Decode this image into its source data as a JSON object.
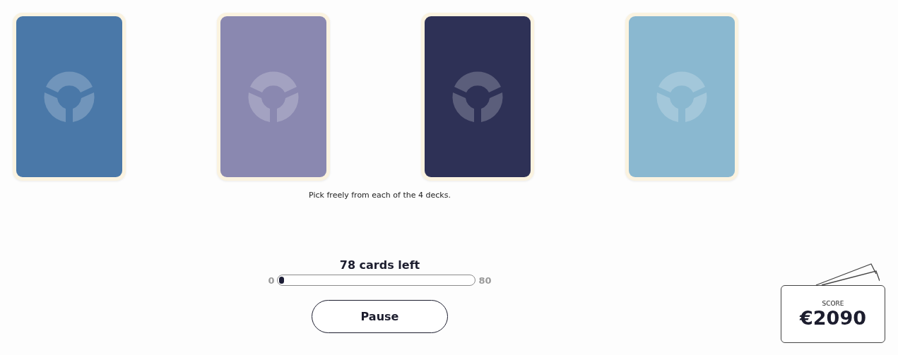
{
  "decks": [
    {
      "color": "#4a78a8"
    },
    {
      "color": "#8a88b0"
    },
    {
      "color": "#2e3156"
    },
    {
      "color": "#8ab8d0"
    }
  ],
  "instruction": "Pick freely from each of the 4 decks.",
  "progress": {
    "title": "78 cards left",
    "min_label": "0",
    "max_label": "80",
    "level": 0.025
  },
  "pause_button": "Pause",
  "score": {
    "label": "SCORE",
    "value": "€2090"
  }
}
